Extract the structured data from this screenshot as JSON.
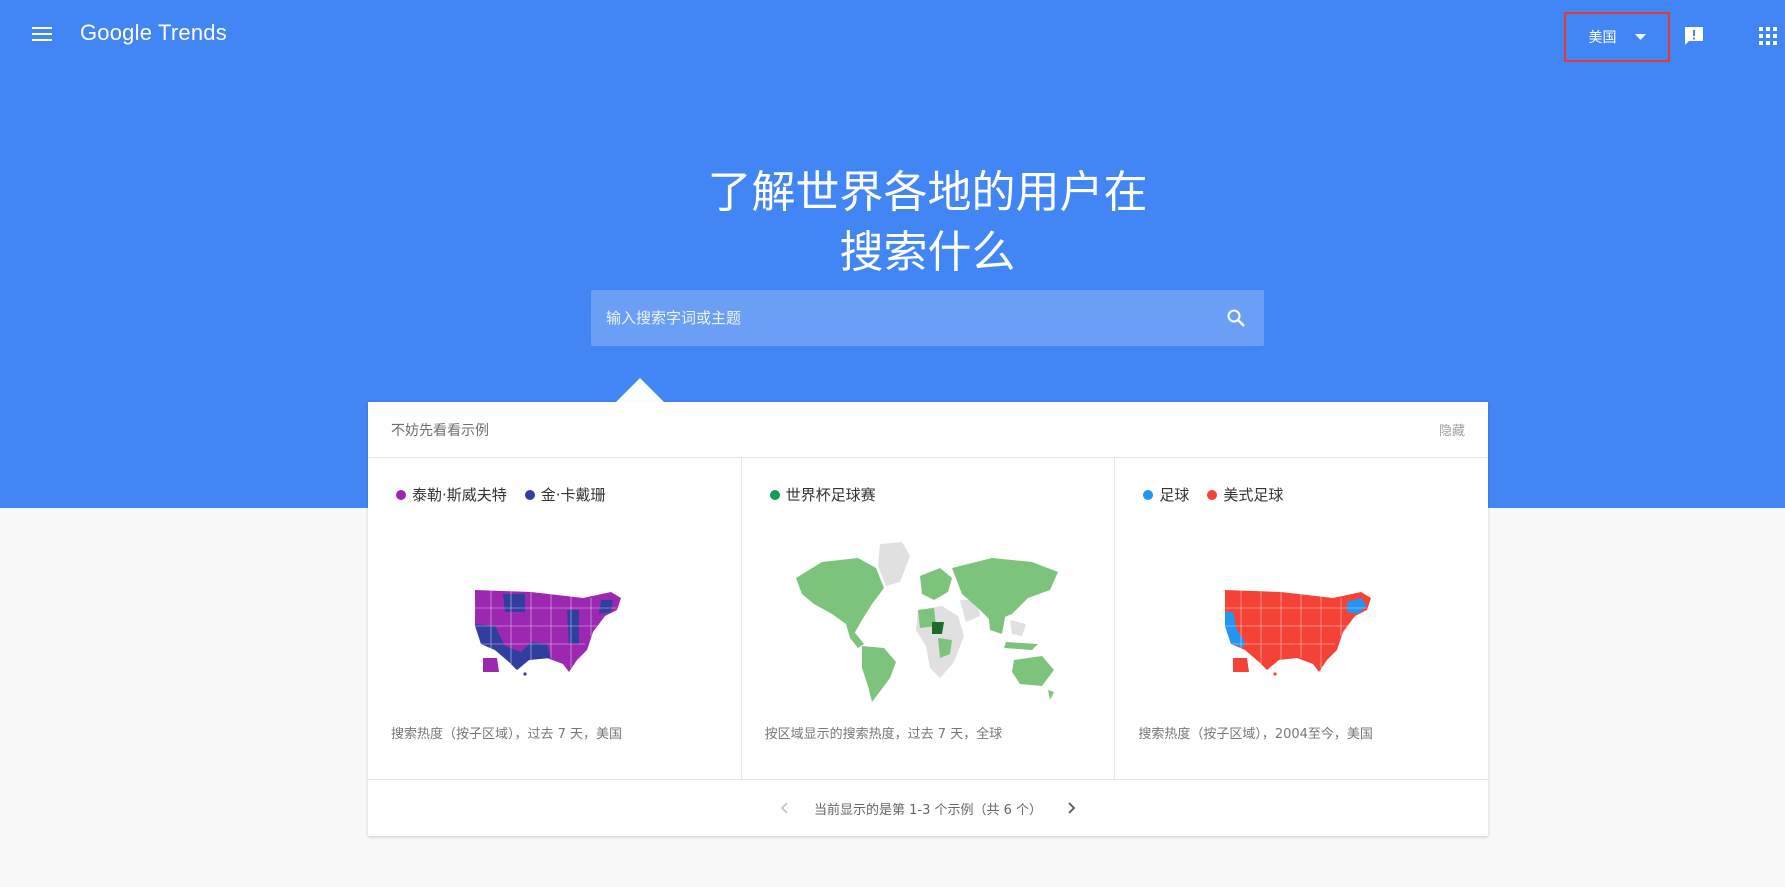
{
  "header": {
    "logo_text": "Google Trends",
    "country_label": "美国"
  },
  "hero": {
    "title_line1": "了解世界各地的用户在",
    "title_line2": "搜索什么"
  },
  "search": {
    "placeholder": "输入搜索字词或主题"
  },
  "examples": {
    "title": "不妨先看看示例",
    "hide_label": "隐藏",
    "items": [
      {
        "legend": [
          {
            "label": "泰勒·斯威夫特",
            "color": "#9c27b0"
          },
          {
            "label": "金·卡戴珊",
            "color": "#303f9f"
          }
        ],
        "caption": "搜索热度（按子区域），过去 7 天，美国"
      },
      {
        "legend": [
          {
            "label": "世界杯足球赛",
            "color": "#0f9d58"
          }
        ],
        "caption": "按区域显示的搜索热度，过去 7 天，全球"
      },
      {
        "legend": [
          {
            "label": "足球",
            "color": "#2196f3"
          },
          {
            "label": "美式足球",
            "color": "#f44336"
          }
        ],
        "caption": "搜索热度（按子区域），2004至今，美国"
      }
    ],
    "pager_text": "当前显示的是第 1-3 个示例（共 6 个）"
  },
  "colors": {
    "hero_blue": "#4285f4",
    "search_bg": "#6b9ff6",
    "highlight_box": "#e53935"
  }
}
